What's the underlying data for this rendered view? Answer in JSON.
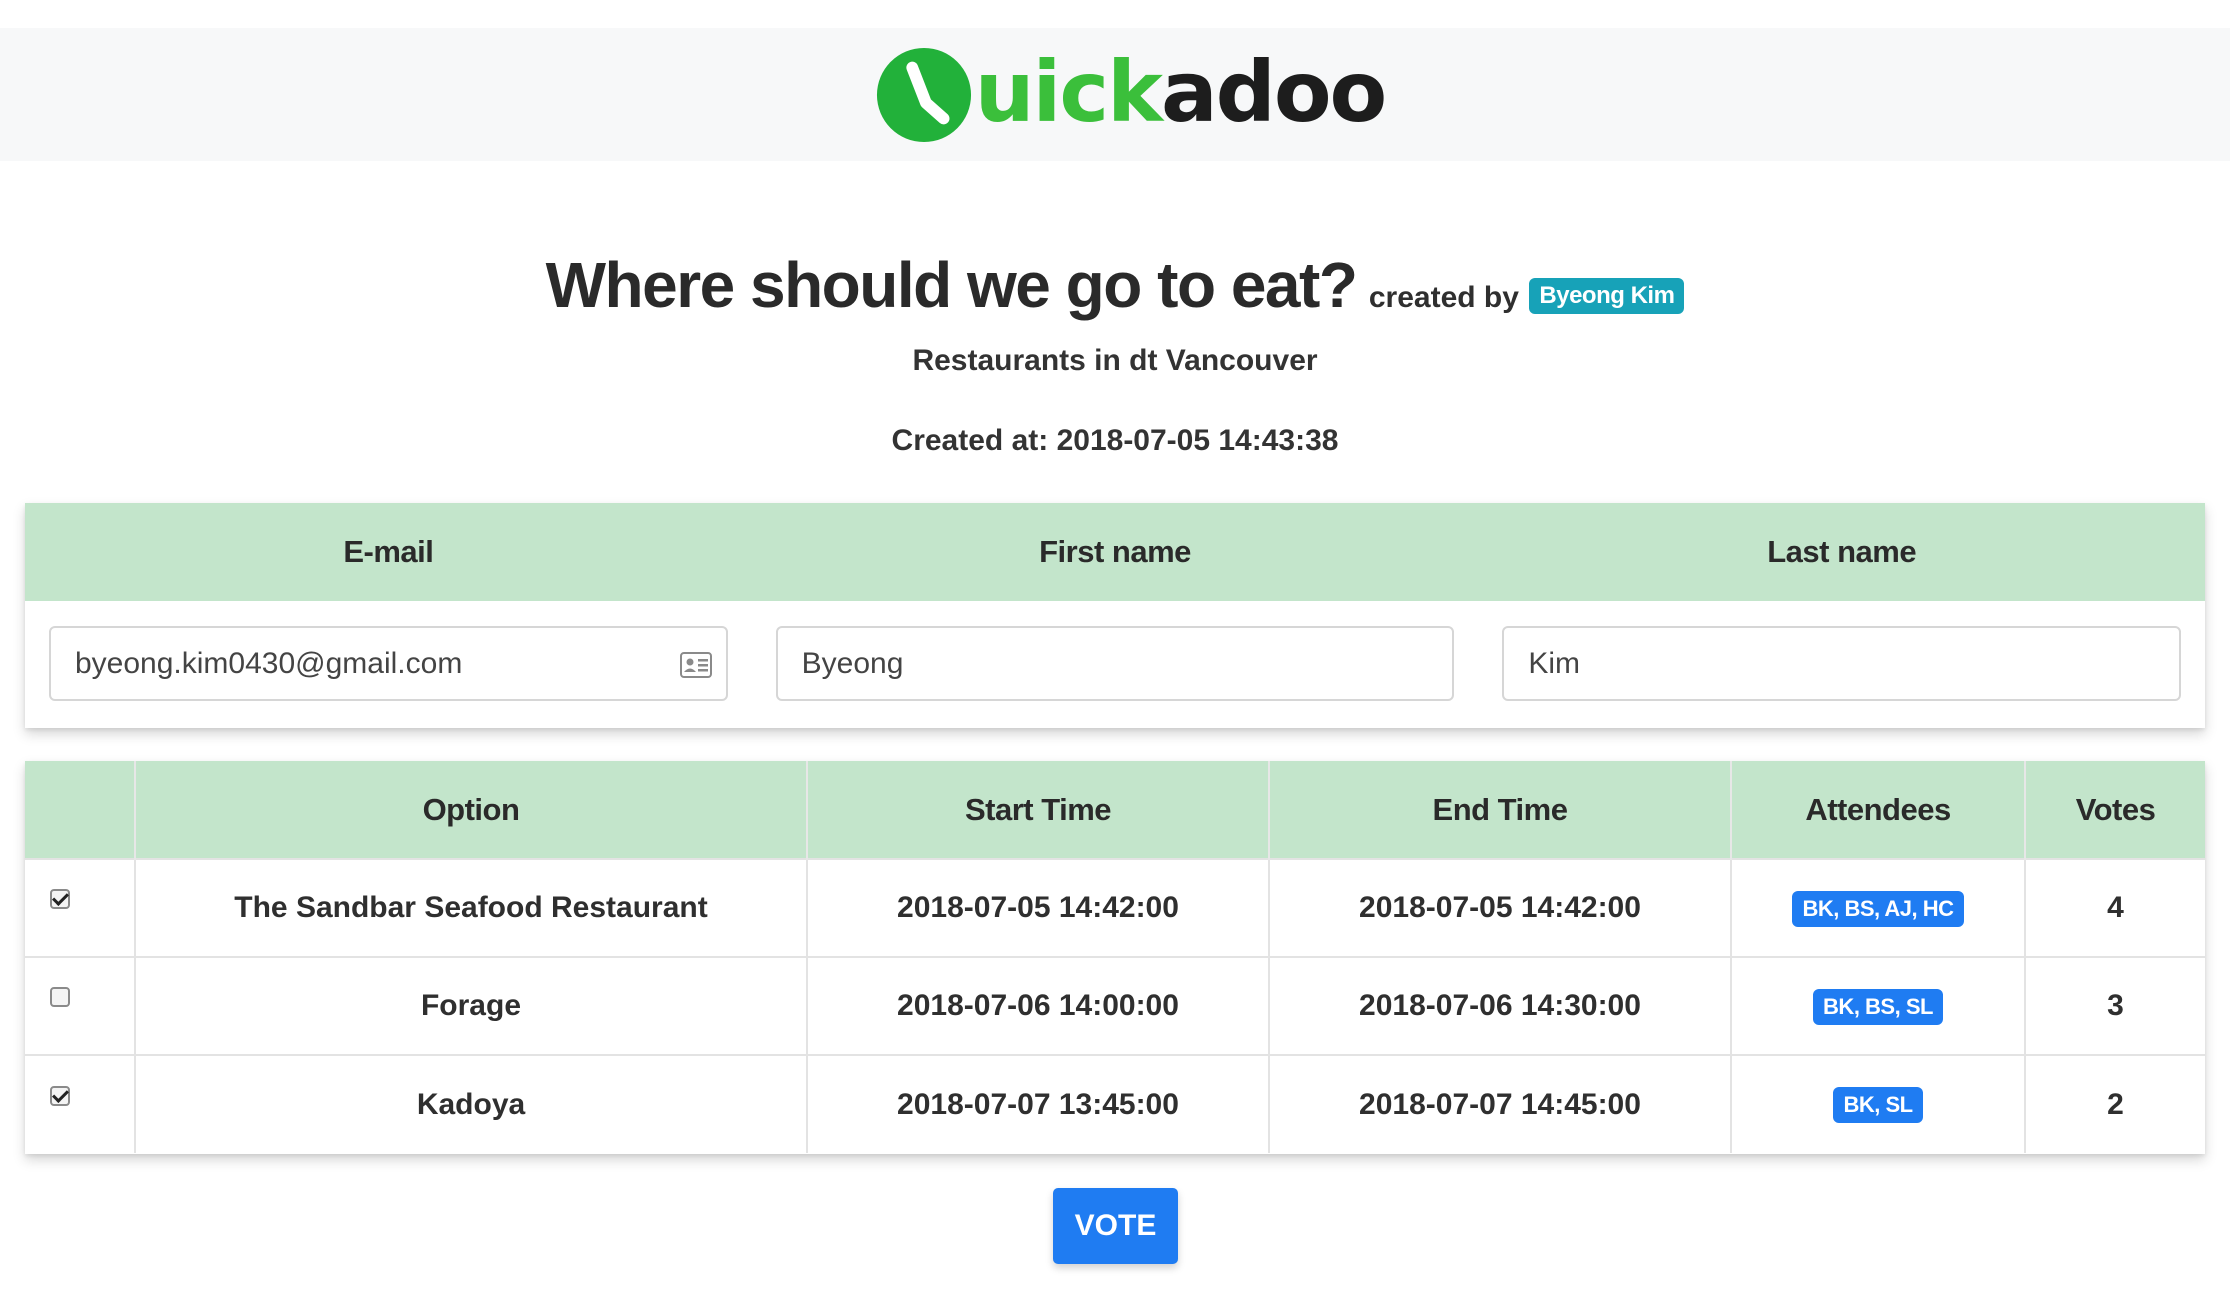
{
  "brand": {
    "logo_text_green": "uick",
    "logo_text_dark": "adoo",
    "primary_green": "#3bbf3b",
    "logo_icon": "clock-icon"
  },
  "poll": {
    "title": "Where should we go to eat?",
    "created_by_label": "created by",
    "author": "Byeong Kim",
    "description": "Restaurants in dt Vancouver",
    "created_at": "Created at: 2018-07-05 14:43:38"
  },
  "user_form": {
    "headers": {
      "email": "E-mail",
      "first_name": "First name",
      "last_name": "Last name"
    },
    "email_value": "byeong.kim0430@gmail.com",
    "email_icon": "contact-card-icon",
    "first_name_value": "Byeong",
    "last_name_value": "Kim"
  },
  "options_table": {
    "headers": {
      "option": "Option",
      "start": "Start Time",
      "end": "End Time",
      "attendees": "Attendees",
      "votes": "Votes"
    },
    "rows": [
      {
        "checked": true,
        "option": "The Sandbar Seafood Restaurant",
        "start": "2018-07-05 14:42:00",
        "end": "2018-07-05 14:42:00",
        "attendees": "BK, BS, AJ, HC",
        "votes": "4"
      },
      {
        "checked": false,
        "option": "Forage",
        "start": "2018-07-06 14:00:00",
        "end": "2018-07-06 14:30:00",
        "attendees": "BK, BS, SL",
        "votes": "3"
      },
      {
        "checked": true,
        "option": "Kadoya",
        "start": "2018-07-07 13:45:00",
        "end": "2018-07-07 14:45:00",
        "attendees": "BK, SL",
        "votes": "2"
      }
    ]
  },
  "actions": {
    "vote_label": "VOTE"
  },
  "colors": {
    "header_row_bg": "#c3e5cb",
    "author_badge": "#17a2b8",
    "attendee_badge": "#1f7cf2",
    "vote_button": "#1f7cf2"
  }
}
